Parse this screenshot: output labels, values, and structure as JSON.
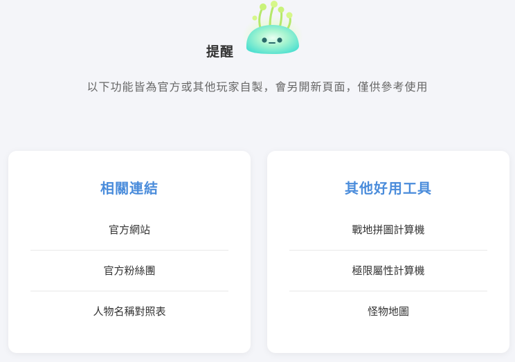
{
  "notice": {
    "title": "提醒",
    "description": "以下功能皆為官方或其他玩家自製，會另開新頁面，僅供參考使用",
    "mascot_icon": "green-slime-mascot-icon"
  },
  "cards": [
    {
      "title": "相關連結",
      "items": [
        "官方網站",
        "官方粉絲團",
        "人物名稱對照表"
      ]
    },
    {
      "title": "其他好用工具",
      "items": [
        "戰地拼圖計算機",
        "極限屬性計算機",
        "怪物地圖"
      ]
    }
  ],
  "colors": {
    "background": "#f4f5f9",
    "card_title": "#4a8cdb",
    "text": "#333333",
    "muted_text": "#666666"
  }
}
